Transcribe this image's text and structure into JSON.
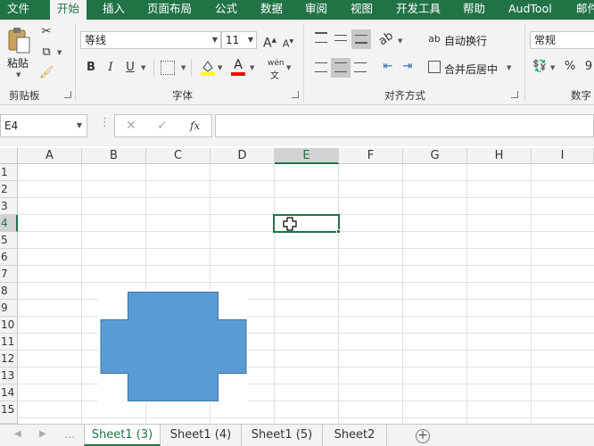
{
  "menu": {
    "tabs": [
      {
        "label": "文件"
      },
      {
        "label": "开始"
      },
      {
        "label": "插入"
      },
      {
        "label": "页面布局"
      },
      {
        "label": "公式"
      },
      {
        "label": "数据"
      },
      {
        "label": "审阅"
      },
      {
        "label": "视图"
      },
      {
        "label": "开发工具"
      },
      {
        "label": "帮助"
      },
      {
        "label": "AudTool"
      },
      {
        "label": "邮件"
      }
    ]
  },
  "ribbon": {
    "clipboard": {
      "label": "剪贴板",
      "paste_label": "粘贴"
    },
    "font": {
      "label": "字体",
      "font_name": "等线",
      "font_size": "11",
      "grow": "A",
      "shrink": "A",
      "bold": "B",
      "italic": "I",
      "underline": "U",
      "font_color": "A",
      "phonetic": "wén"
    },
    "alignment": {
      "label": "对齐方式",
      "wrap_text": "自动换行",
      "merge_center": "合并后居中"
    },
    "number": {
      "label": "数字",
      "format": "常规",
      "percent": "%",
      "comma": "9"
    }
  },
  "formula_bar": {
    "name_box": "E4",
    "fx": "fx",
    "formula": ""
  },
  "grid": {
    "columns": [
      "A",
      "B",
      "C",
      "D",
      "E",
      "F",
      "G",
      "H",
      "I"
    ],
    "rows": [
      "1",
      "2",
      "3",
      "4",
      "5",
      "6",
      "7",
      "8",
      "9",
      "10",
      "11",
      "12",
      "13",
      "14",
      "15"
    ],
    "selected_cell": "E4"
  },
  "shape": {
    "type": "cross",
    "color": "#5b9bd5",
    "border": "#41719c"
  },
  "sheets": [
    {
      "name": "Sheet1 (3)",
      "active": true
    },
    {
      "name": "Sheet1 (4)",
      "active": false
    },
    {
      "name": "Sheet1 (5)",
      "active": false
    },
    {
      "name": "Sheet2",
      "active": false
    }
  ],
  "colors": {
    "accent": "#217346"
  }
}
